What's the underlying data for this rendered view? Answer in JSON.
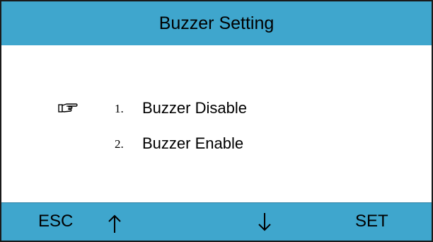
{
  "window": {
    "title": "Buzzer Setting"
  },
  "menu": {
    "items": [
      {
        "number": "1.",
        "label": "Buzzer Disable",
        "selected": true
      },
      {
        "number": "2.",
        "label": "Buzzer Enable",
        "selected": false
      }
    ],
    "selection_icon": "pointing-hand-icon"
  },
  "softkeys": {
    "esc_label": "ESC",
    "up_icon": "up-arrow-icon",
    "down_icon": "down-arrow-icon",
    "set_label": "SET"
  },
  "colors": {
    "bar_background": "#3fa6cd",
    "screen_background": "#ffffff",
    "text": "#000000"
  }
}
